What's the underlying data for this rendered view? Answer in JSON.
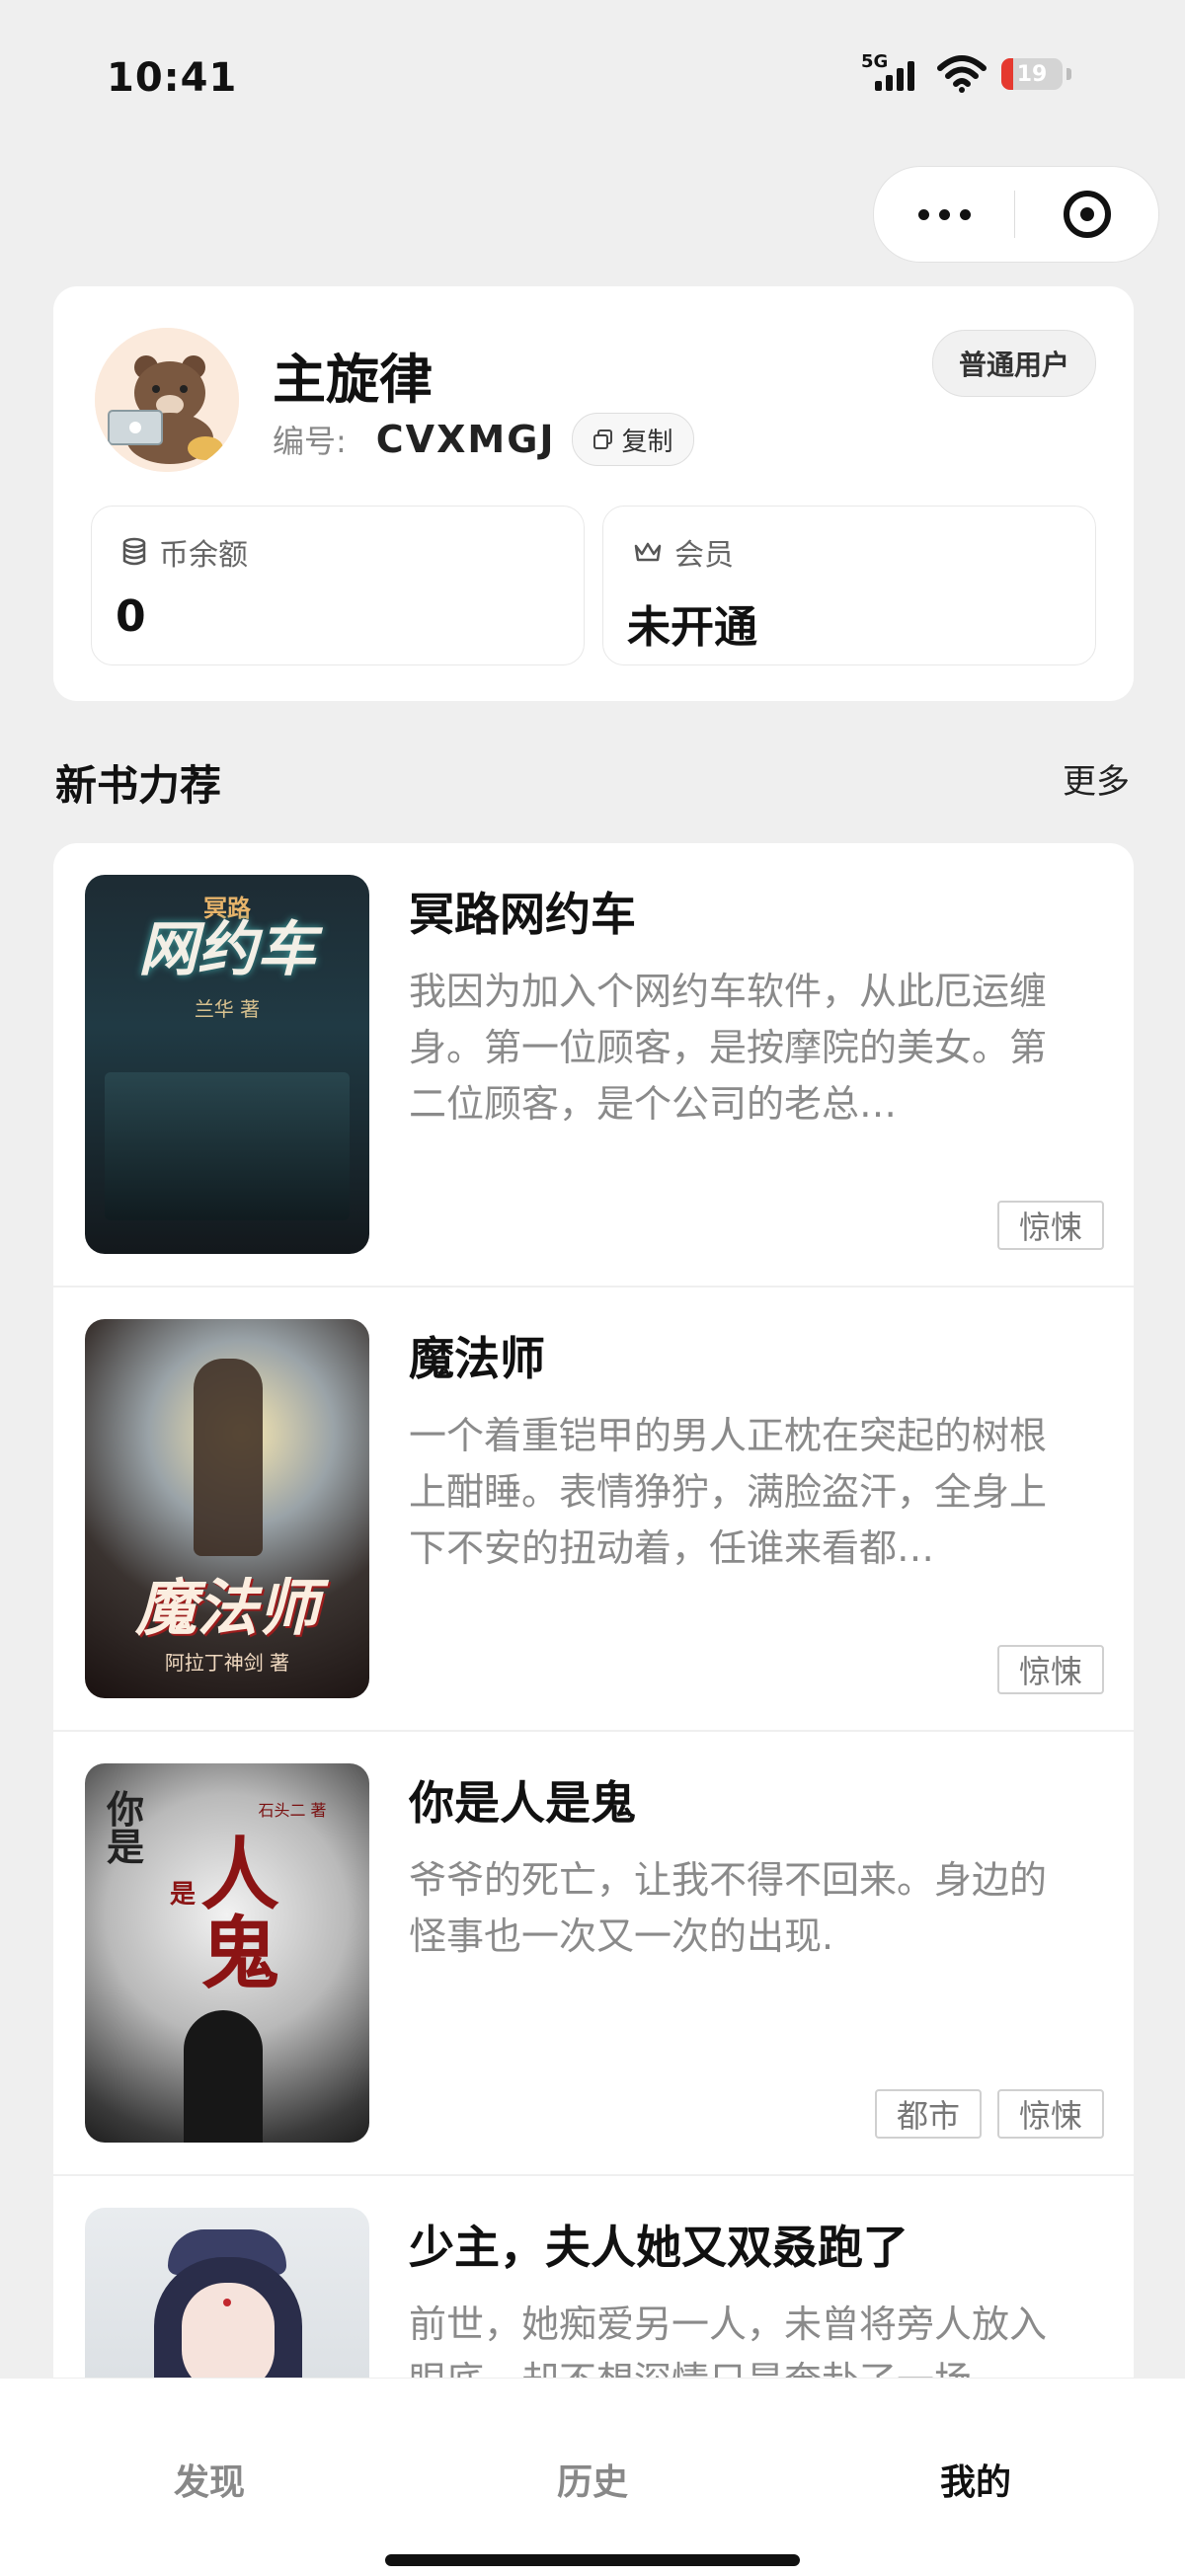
{
  "status_bar": {
    "time": "10:41",
    "network": "5G",
    "battery": "19",
    "battery_level": 0.19
  },
  "profile": {
    "name": "主旋律",
    "badge": "普通用户",
    "id_label": "编号:",
    "id_value": "CVXMGJ",
    "copy_label": "复制",
    "coins_label": "币余额",
    "coins_value": "0",
    "member_label": "会员",
    "member_value": "未开通"
  },
  "section": {
    "title": "新书力荐",
    "more": "更多"
  },
  "books": [
    {
      "title": "冥路网约车",
      "desc": "我因为加入个网约车软件，从此厄运缠身。第一位顾客，是按摩院的美女。第二位顾客，是个公司的老总…",
      "tags": [
        "惊悚"
      ],
      "cover": {
        "top": "冥路",
        "main": "网约车",
        "author": "兰华 著"
      }
    },
    {
      "title": "魔法师",
      "desc": "一个着重铠甲的男人正枕在突起的树根上酣睡。表情狰狞，满脸盗汗，全身上下不安的扭动着，任谁来看都…",
      "tags": [
        "惊悚"
      ],
      "cover": {
        "main": "魔法师",
        "author": "阿拉丁神剑 著"
      }
    },
    {
      "title": "你是人是鬼",
      "desc": "爷爷的死亡，让我不得不回来。身边的怪事也一次又一次的出现.",
      "tags": [
        "都市",
        "惊悚"
      ],
      "cover": {
        "left": "你是",
        "mid": "是",
        "main": "人鬼",
        "author": "石头二 著"
      }
    },
    {
      "title": "少主，夫人她又双叒跑了",
      "desc": "前世，她痴爱另一人，未曾将旁人放入眼底，却不想深情只是奔赴了一场…",
      "tags": [],
      "cover": {}
    }
  ],
  "nav": {
    "discover": "发现",
    "history": "历史",
    "mine": "我的"
  }
}
